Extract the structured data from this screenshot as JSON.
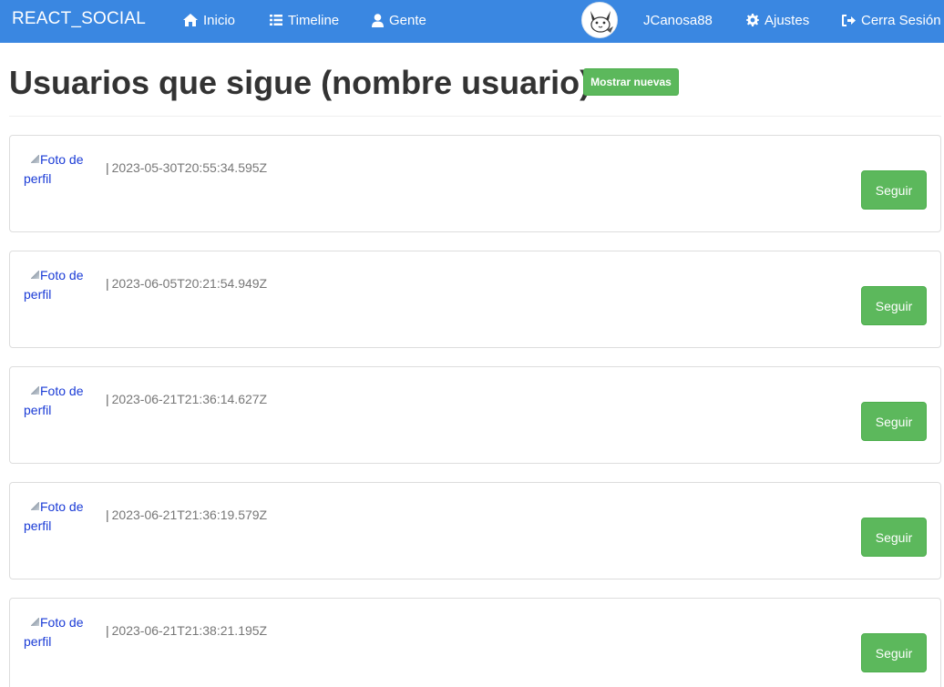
{
  "navbar": {
    "brand": "REACT_SOCIAL",
    "links": [
      {
        "label": "Inicio",
        "icon": "home-icon"
      },
      {
        "label": "Timeline",
        "icon": "list-icon"
      },
      {
        "label": "Gente",
        "icon": "user-icon"
      }
    ],
    "username": "JCanosa88",
    "settings_label": "Ajustes",
    "logout_label": "Cerra Sesión",
    "color": "#3a87e1"
  },
  "page": {
    "title": "Usuarios que sigue (nombre usuario)",
    "show_new_label": "Mostrar nuevas"
  },
  "users": [
    {
      "photo_alt_1": "Foto de",
      "photo_alt_2": "perfil",
      "separator": "|",
      "created_at": "2023-05-30T20:55:34.595Z",
      "action": "Seguir"
    },
    {
      "photo_alt_1": "Foto de",
      "photo_alt_2": "perfil",
      "separator": "|",
      "created_at": "2023-06-05T20:21:54.949Z",
      "action": "Seguir"
    },
    {
      "photo_alt_1": "Foto de",
      "photo_alt_2": "perfil",
      "separator": "|",
      "created_at": "2023-06-21T21:36:14.627Z",
      "action": "Seguir"
    },
    {
      "photo_alt_1": "Foto de",
      "photo_alt_2": "perfil",
      "separator": "|",
      "created_at": "2023-06-21T21:36:19.579Z",
      "action": "Seguir"
    },
    {
      "photo_alt_1": "Foto de",
      "photo_alt_2": "perfil",
      "separator": "|",
      "created_at": "2023-06-21T21:38:21.195Z",
      "action": "Seguir"
    }
  ],
  "colors": {
    "success": "#5cb85c",
    "link": "#1a3bd6"
  }
}
